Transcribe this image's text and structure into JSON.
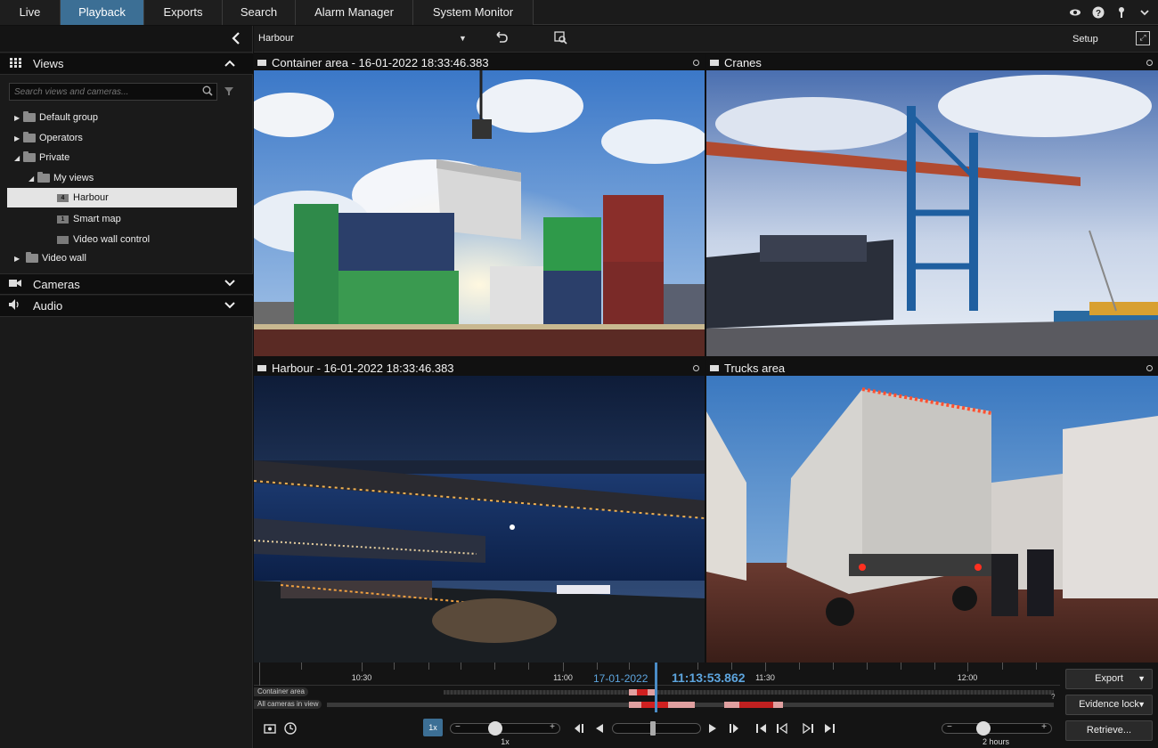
{
  "tabs": [
    {
      "label": "Live"
    },
    {
      "label": "Playback"
    },
    {
      "label": "Exports"
    },
    {
      "label": "Search"
    },
    {
      "label": "Alarm Manager"
    },
    {
      "label": "System Monitor"
    }
  ],
  "sidebar": {
    "views_label": "Views",
    "search_placeholder": "Search views and cameras...",
    "tree": [
      {
        "label": "Default group"
      },
      {
        "label": "Operators"
      },
      {
        "label": "Private"
      },
      {
        "label": "My views"
      },
      {
        "label": "Harbour",
        "badge": "4"
      },
      {
        "label": "Smart map",
        "badge": "1"
      },
      {
        "label": "Video wall control"
      },
      {
        "label": "Video wall"
      }
    ],
    "cameras_label": "Cameras",
    "audio_label": "Audio"
  },
  "viewbar": {
    "view_name": "Harbour",
    "setup_label": "Setup"
  },
  "tiles": [
    {
      "title": "Container area - 16-01-2022 18:33:46.383"
    },
    {
      "title": "Cranes"
    },
    {
      "title": "Harbour - 16-01-2022 18:33:46.383"
    },
    {
      "title": "Trucks area"
    }
  ],
  "timeline": {
    "ticks": [
      "10:30",
      "11:00",
      "11:30",
      "12:00"
    ],
    "date": "17-01-2022",
    "time": "11:13:53.862",
    "tracks": [
      {
        "label": "Container area"
      },
      {
        "label": "All cameras in view"
      }
    ],
    "help": "?"
  },
  "controls": {
    "speed": "1x",
    "speed_label": "1x",
    "span_label": "2 hours"
  },
  "buttons": {
    "export": "Export",
    "evidence_lock": "Evidence lock",
    "retrieve": "Retrieve..."
  }
}
